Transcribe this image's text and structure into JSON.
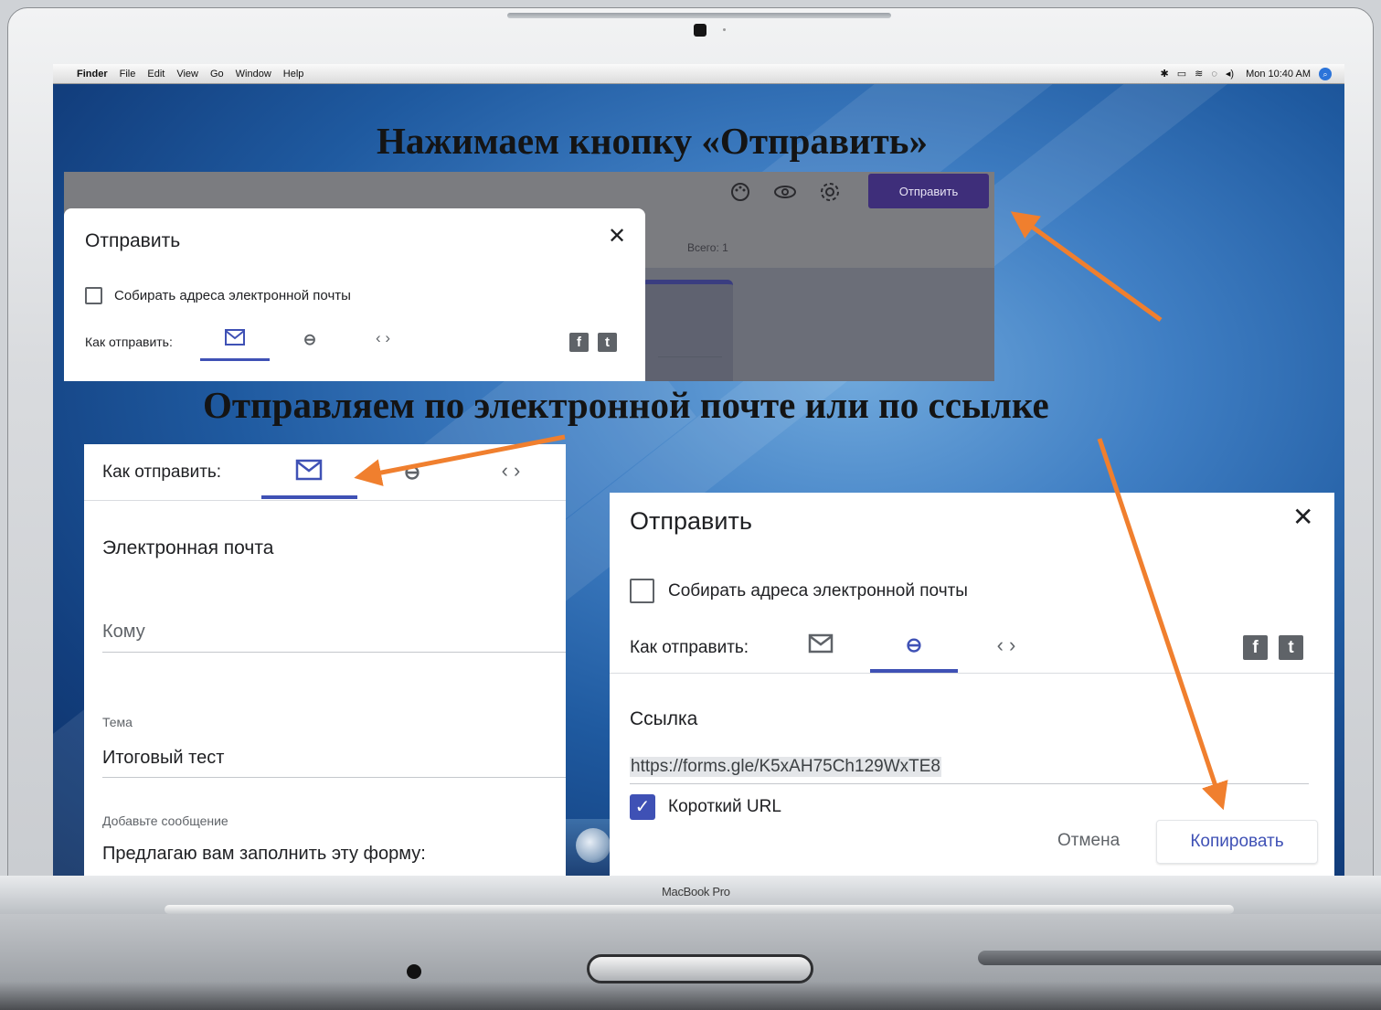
{
  "menubar": {
    "apple": "",
    "items": [
      "Finder",
      "File",
      "Edit",
      "View",
      "Go",
      "Window",
      "Help"
    ],
    "clock": "Mon 10:40 AM",
    "status_icons": [
      "bluetooth-icon",
      "battery-icon",
      "wifi-icon",
      "timemachine-icon",
      "volume-icon",
      "spotlight-icon"
    ]
  },
  "headings": {
    "top": "Нажимаем кнопку «Отправить»",
    "middle": "Отправляем по электронной почте или по ссылке"
  },
  "panel1": {
    "send_button": "Отправить",
    "total": "Всего: 1",
    "dialog_title": "Отправить",
    "collect_emails": "Собирать адреса электронной почты",
    "how_to_send": "Как отправить:",
    "tab_icons": [
      "mail-icon",
      "link-icon",
      "embed-icon"
    ],
    "active_tab": "mail",
    "social": [
      "f",
      "t"
    ]
  },
  "panel2": {
    "how_to_send": "Как отправить:",
    "section_title": "Электронная почта",
    "to_placeholder": "Кому",
    "subject_label": "Тема",
    "subject_value": "Итоговый тест",
    "message_label": "Добавьте сообщение",
    "message_value": "Предлагаю вам заполнить эту форму:",
    "active_tab": "mail"
  },
  "panel3": {
    "dialog_title": "Отправить",
    "collect_emails": "Собирать адреса электронной почты",
    "how_to_send": "Как отправить:",
    "active_tab": "link",
    "section_title": "Ссылка",
    "link": "https://forms.gle/K5xAH75Ch129WxTE8",
    "short_url": "Короткий URL",
    "short_url_checked": true,
    "cancel": "Отмена",
    "copy": "Копировать",
    "social": [
      "f",
      "t"
    ]
  },
  "laptop": {
    "brand": "MacBook Pro"
  },
  "colors": {
    "accent": "#3f51b5",
    "arrow": "#f07f2e",
    "send_button": "#3e2e7a"
  }
}
